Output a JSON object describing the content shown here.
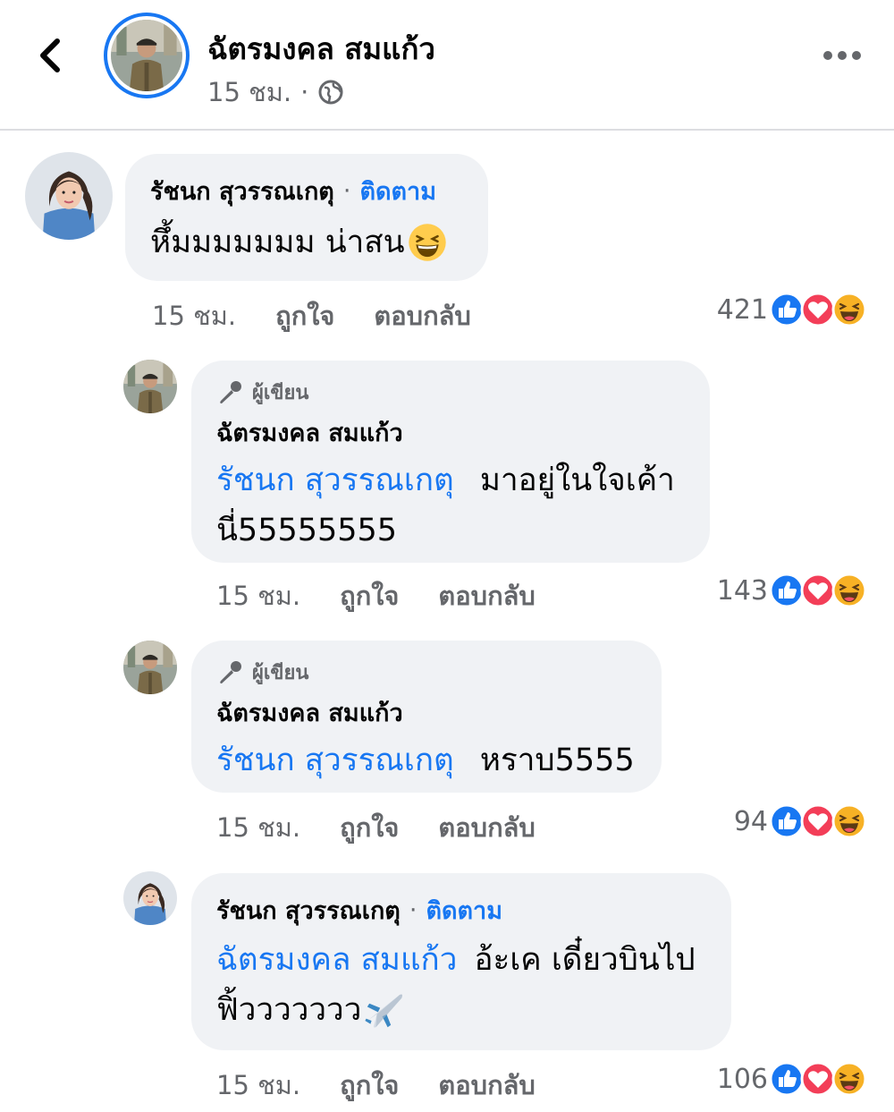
{
  "header": {
    "back_icon": "chevron-left-icon",
    "name": "ฉัตรมงคล สมแก้ว",
    "time": "15 ชม.",
    "separator": "·",
    "privacy_icon": "globe-icon",
    "more_icon": "more-horizontal-icon"
  },
  "comments": [
    {
      "author": "รัชนก สุวรรณเกตุ",
      "separator": "·",
      "follow_label": "ติดตาม",
      "text": "หึ้มมมมมมม น่าสน",
      "emoji": "😆",
      "time": "15 ชม.",
      "like_label": "ถูกใจ",
      "reply_label": "ตอบกลับ",
      "reaction_count": "421"
    },
    {
      "badge": "ผู้เขียน",
      "author": "ฉัตรมงคล สมแก้ว",
      "mention": "รัชนก สุวรรณเกตุ",
      "text_line1": "มาอยู่ในใจเค้า",
      "text_line2": "นี่55555555",
      "time": "15 ชม.",
      "like_label": "ถูกใจ",
      "reply_label": "ตอบกลับ",
      "reaction_count": "143"
    },
    {
      "badge": "ผู้เขียน",
      "author": "ฉัตรมงคล สมแก้ว",
      "mention": "รัชนก สุวรรณเกตุ",
      "text": "หราบ5555",
      "time": "15 ชม.",
      "like_label": "ถูกใจ",
      "reply_label": "ตอบกลับ",
      "reaction_count": "94"
    },
    {
      "author": "รัชนก สุวรรณเกตุ",
      "separator": "·",
      "follow_label": "ติดตาม",
      "mention": "ฉัตรมงคล สมแก้ว",
      "text_line1": "อ้ะเค เดี๋ยวบินไป",
      "text_line2": "ฟิ้ววววววว",
      "emoji": "✈️",
      "time": "15 ชม.",
      "like_label": "ถูกใจ",
      "reply_label": "ตอบกลับ",
      "reaction_count": "106"
    }
  ],
  "reaction_icons": [
    "like-icon",
    "love-icon",
    "haha-icon"
  ],
  "colors": {
    "accent": "#1877f2",
    "bubble": "#f0f2f5",
    "secondary_text": "#65676b",
    "love": "#f33e58",
    "haha": "#f7b125"
  }
}
